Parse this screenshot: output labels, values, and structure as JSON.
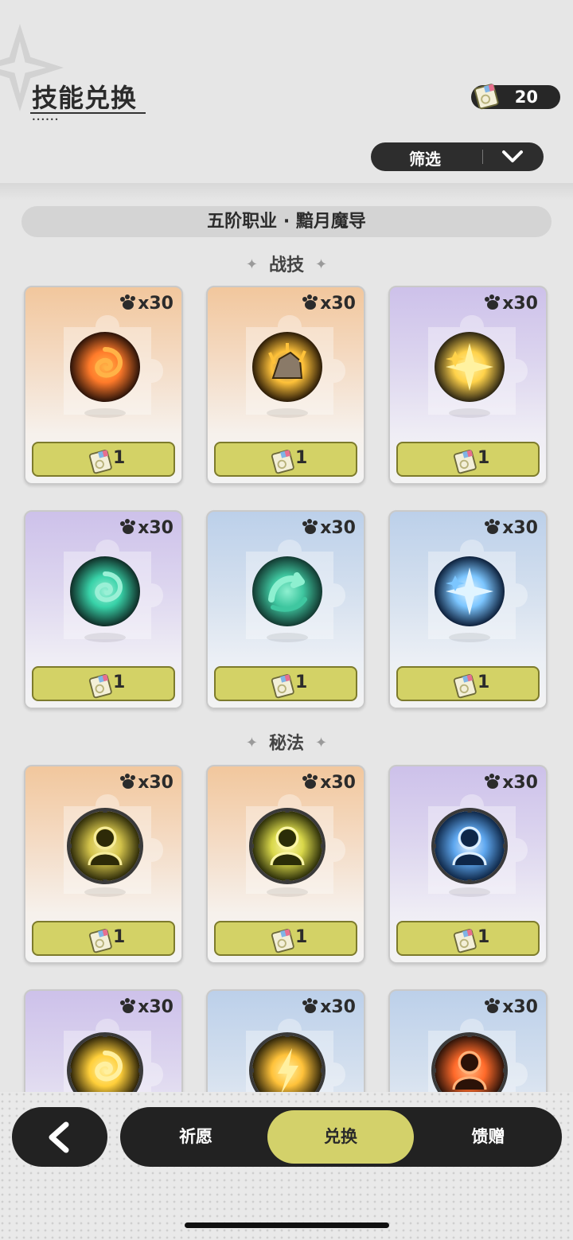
{
  "header": {
    "title": "技能兑换",
    "currency_value": "20"
  },
  "filter": {
    "label": "筛选"
  },
  "class_banner": "五阶职业 · 黯月魔导",
  "sections": [
    {
      "title": "战技",
      "cards": [
        {
          "tint": "orange",
          "count": "x30",
          "cost": "1",
          "orb": "fire-vortex"
        },
        {
          "tint": "orange",
          "count": "x30",
          "cost": "1",
          "orb": "rock-blast"
        },
        {
          "tint": "purple",
          "count": "x30",
          "cost": "1",
          "orb": "star-burst"
        },
        {
          "tint": "purple",
          "count": "x30",
          "cost": "1",
          "orb": "wind-swirl"
        },
        {
          "tint": "blue",
          "count": "x30",
          "cost": "1",
          "orb": "wind-arrow"
        },
        {
          "tint": "blue",
          "count": "x30",
          "cost": "1",
          "orb": "ice-crystal"
        }
      ]
    },
    {
      "title": "秘法",
      "cards": [
        {
          "tint": "orange",
          "count": "x30",
          "cost": "1",
          "orb": "shield-figure"
        },
        {
          "tint": "orange",
          "count": "x30",
          "cost": "1",
          "orb": "heal-figure"
        },
        {
          "tint": "purple",
          "count": "x30",
          "cost": "1",
          "orb": "frost-figure"
        },
        {
          "tint": "purple",
          "count": "x30",
          "orb": "gold-storm"
        },
        {
          "tint": "blue",
          "count": "x30",
          "orb": "lightning-figure"
        },
        {
          "tint": "blue",
          "count": "x30",
          "orb": "fire-figure"
        }
      ]
    }
  ],
  "tabs": [
    {
      "label": "祈愿",
      "active": false
    },
    {
      "label": "兑换",
      "active": true
    },
    {
      "label": "馈赠",
      "active": false
    }
  ],
  "colors": {
    "accent": "#d3d16a",
    "dark": "#222222"
  }
}
